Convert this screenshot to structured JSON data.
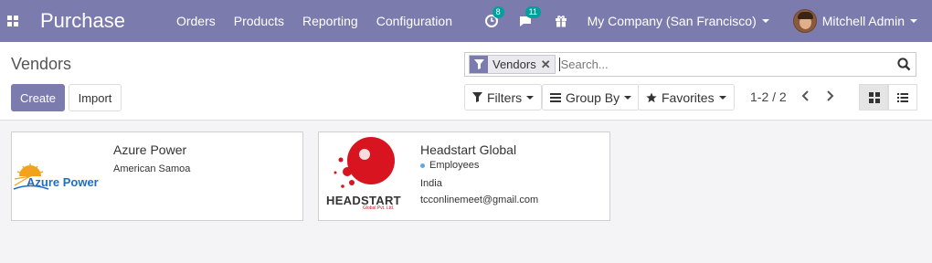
{
  "navbar": {
    "brand": "Purchase",
    "menu": [
      "Orders",
      "Products",
      "Reporting",
      "Configuration"
    ],
    "activity_count": "8",
    "messages_count": "11",
    "company": "My Company (San Francisco)",
    "user": "Mitchell Admin",
    "color": "#7c7bad"
  },
  "control_panel": {
    "breadcrumb": "Vendors",
    "create_label": "Create",
    "import_label": "Import",
    "search": {
      "facet_label": "Vendors",
      "placeholder": "Search..."
    },
    "filters_label": "Filters",
    "groupby_label": "Group By",
    "favorites_label": "Favorites",
    "pager": "1-2 / 2"
  },
  "cards": [
    {
      "name": "Azure Power",
      "logo_text": "Azure Power",
      "country": "American Samoa"
    },
    {
      "name": "Headstart Global",
      "logo_text": "HEADSTART",
      "logo_subtext": "Global Pvt. Ltd.",
      "tag": "Employees",
      "country": "India",
      "email": "tcconlinemeet@gmail.com"
    }
  ],
  "icons": {
    "apps": "apps-grid-icon",
    "activity": "clock-icon",
    "messages": "chat-bubble-icon",
    "gift": "gift-icon",
    "filter": "funnel-icon",
    "groupby": "list-icon",
    "favorites": "star-icon",
    "kanban": "kanban-grid-icon",
    "list": "list-view-icon"
  }
}
